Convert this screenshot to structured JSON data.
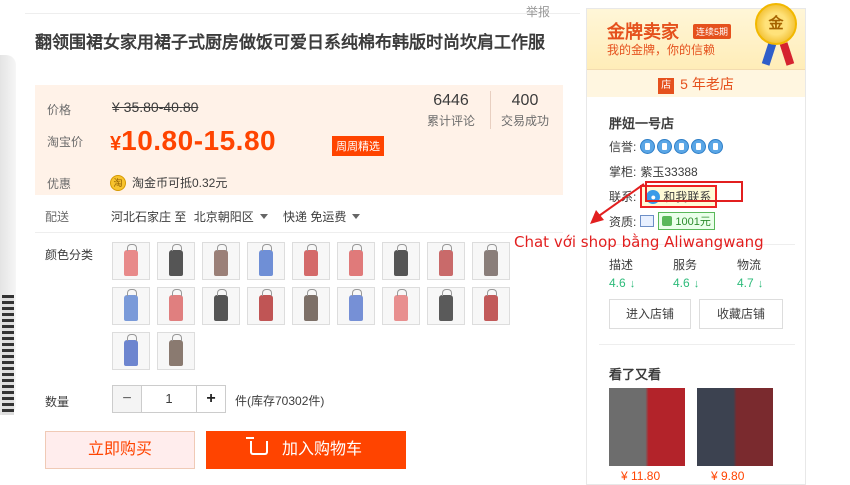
{
  "top": {
    "report": "举报"
  },
  "title": "翻领围裙女家用裙子式厨房做饭可爱日系纯棉布韩版时尚坎肩工作服",
  "price": {
    "label": "价格",
    "original": "¥ 35.80-40.80",
    "promo_label": "淘宝价",
    "promo_yen": "¥",
    "promo_value": "10.80-15.80",
    "promo_badge": "周周精选",
    "reviews_num": "6446",
    "reviews_label": "累计评论",
    "deals_num": "400",
    "deals_label": "交易成功",
    "discount_label": "优惠",
    "coin_icon": "淘",
    "coin_text": "淘金币可抵0.32元"
  },
  "shipping": {
    "label": "配送",
    "from": "河北石家庄 至",
    "to": "北京朝阳区",
    "method": "快递 免运费"
  },
  "colors": {
    "label": "颜色分类",
    "swatches": [
      "#e88a8a",
      "#555555",
      "#9b8078",
      "#6f8fd6",
      "#d46a6a",
      "#e07a7a",
      "#555555",
      "#c96a6a",
      "#8a7e7a",
      "#7a9ad9",
      "#e07f7f",
      "#555555",
      "#c05555",
      "#7d7068",
      "#7690d6",
      "#e88f8f",
      "#5a5a5a",
      "#c25a5a",
      "#6d85cf",
      "#8a7a70"
    ]
  },
  "quantity": {
    "label": "数量",
    "minus": "−",
    "value": "1",
    "plus": "+",
    "stock": "件(库存70302件)"
  },
  "actions": {
    "buy_now": "立即购买",
    "add_cart": "加入购物车"
  },
  "sidebar": {
    "gold_title": "金牌卖家",
    "gold_tag": "连续5期",
    "gold_sub": "我的金牌，你的信赖",
    "medal": "金",
    "years_icon": "店",
    "years": "5 年老店",
    "shop_name": "胖妞一号店",
    "credit_label": "信誉:",
    "owner_label": "掌柜:",
    "owner": "紫玉33388",
    "contact_label": "联系:",
    "contact_btn": "和我联系",
    "quality_label": "资质:",
    "quality_badge": "1001元",
    "ratings": [
      {
        "label": "描述",
        "value": "4.6"
      },
      {
        "label": "服务",
        "value": "4.6"
      },
      {
        "label": "物流",
        "value": "4.7"
      }
    ],
    "enter_shop": "进入店铺",
    "fav_shop": "收藏店铺",
    "seen_title": "看了又看",
    "rec_prices": [
      "¥ 11.80",
      "¥ 9.80"
    ]
  },
  "annotation": "Chat với shop bằng Aliwangwang",
  "theme": {
    "accent": "#ff4400",
    "annotation": "#e21f1f"
  }
}
